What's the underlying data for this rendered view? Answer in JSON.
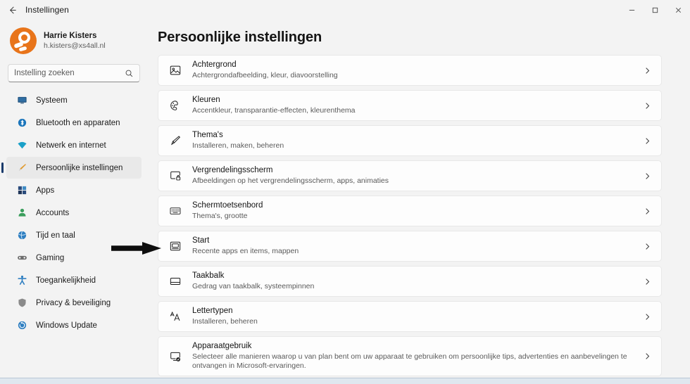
{
  "window": {
    "title": "Instellingen",
    "back_icon": "arrow-left-icon",
    "minimize_label": "–",
    "maximize_label": "□",
    "close_label": "×"
  },
  "account": {
    "name": "Harrie Kisters",
    "email": "h.kisters@xs4all.nl",
    "avatar_color": "#e8741a"
  },
  "search": {
    "placeholder": "Instelling zoeken",
    "value": "",
    "icon": "search-icon"
  },
  "sidebar": {
    "items": [
      {
        "label": "Systeem",
        "icon": "monitor-icon",
        "color": "#1f4e79",
        "selected": false
      },
      {
        "label": "Bluetooth en apparaten",
        "icon": "bluetooth-icon",
        "color": "#1b75bb",
        "selected": false
      },
      {
        "label": "Netwerk en internet",
        "icon": "wifi-icon",
        "color": "#1aa0c8",
        "selected": false
      },
      {
        "label": "Persoonlijke instellingen",
        "icon": "paintbrush-icon",
        "color": "#e09a2e",
        "selected": true
      },
      {
        "label": "Apps",
        "icon": "apps-grid-icon",
        "color": "#2a4b7c",
        "selected": false
      },
      {
        "label": "Accounts",
        "icon": "person-icon",
        "color": "#3a9e5c",
        "selected": false
      },
      {
        "label": "Tijd en taal",
        "icon": "clock-globe-icon",
        "color": "#2f7fc1",
        "selected": false
      },
      {
        "label": "Gaming",
        "icon": "gamepad-icon",
        "color": "#6e6e6e",
        "selected": false
      },
      {
        "label": "Toegankelijkheid",
        "icon": "accessibility-icon",
        "color": "#2f7fc1",
        "selected": false
      },
      {
        "label": "Privacy & beveiliging",
        "icon": "shield-icon",
        "color": "#7a7a7a",
        "selected": false
      },
      {
        "label": "Windows Update",
        "icon": "update-icon",
        "color": "#2f7fc1",
        "selected": false
      }
    ],
    "selection_indicator_color": "#1a3a6b"
  },
  "main": {
    "page_title": "Persoonlijke instellingen",
    "cards": [
      {
        "title": "Achtergrond",
        "desc": "Achtergrondafbeelding, kleur, diavoorstelling",
        "icon": "picture-icon"
      },
      {
        "title": "Kleuren",
        "desc": "Accentkleur, transparantie-effecten, kleurenthema",
        "icon": "palette-icon"
      },
      {
        "title": "Thema's",
        "desc": "Installeren, maken, beheren",
        "icon": "paintbrush-icon"
      },
      {
        "title": "Vergrendelingsscherm",
        "desc": "Afbeeldingen op het vergrendelingsscherm, apps, animaties",
        "icon": "lock-screen-icon"
      },
      {
        "title": "Schermtoetsenbord",
        "desc": "Thema's, grootte",
        "icon": "keyboard-icon"
      },
      {
        "title": "Start",
        "desc": "Recente apps en items, mappen",
        "icon": "start-menu-icon"
      },
      {
        "title": "Taakbalk",
        "desc": "Gedrag van taakbalk, systeempinnen",
        "icon": "taskbar-icon"
      },
      {
        "title": "Lettertypen",
        "desc": "Installeren, beheren",
        "icon": "fonts-aa-icon"
      },
      {
        "title": "Apparaatgebruik",
        "desc": "Selecteer alle manieren waarop u van plan bent om uw apparaat te gebruiken om persoonlijke tips, advertenties en aanbevelingen te ontvangen in Microsoft-ervaringen.",
        "icon": "device-usage-icon"
      }
    ],
    "chevron_icon": "chevron-right-icon"
  },
  "annotation": {
    "arrow_icon": "pointer-arrow-icon",
    "arrow_color": "#0d0d0d",
    "points_at": "Start"
  }
}
